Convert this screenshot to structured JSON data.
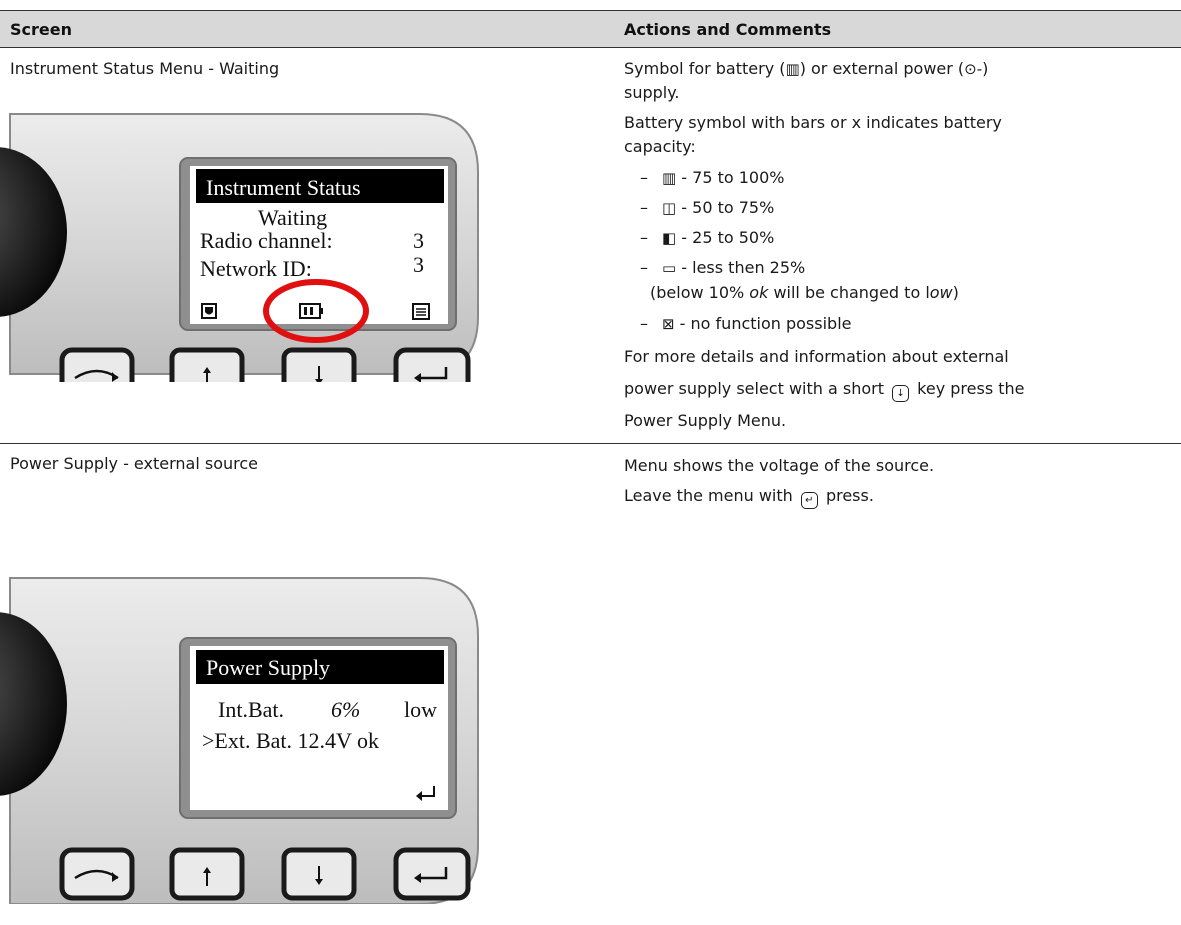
{
  "table": {
    "header": {
      "screen": "Screen",
      "actions": "Actions and Comments"
    }
  },
  "rows": [
    {
      "title": "Instrument Status Menu - Waiting",
      "lcd": {
        "heading": "Instrument Status",
        "line1": "Waiting",
        "line2_label": "Radio channel:",
        "line2_value": "3",
        "line3_label": "Network ID:",
        "line3_value": "3"
      },
      "comments": {
        "p1_a": "Symbol for battery (",
        "p1_sym_battery": "▥",
        "p1_b": ") or external power (",
        "p1_sym_ext": "⊙-",
        "p1_c": ")",
        "p1_line2": "supply.",
        "p2_line1": "Battery symbol with bars or x indicates battery",
        "p2_line2": "capacity:",
        "items": [
          {
            "dash": "–",
            "sym": "▥",
            "text": " - 75 to 100%"
          },
          {
            "dash": "–",
            "sym": "◫",
            "text": " - 50 to 75%"
          },
          {
            "dash": "–",
            "sym": "◧",
            "text": " - 25 to 50%"
          },
          {
            "dash": "–",
            "sym": "▭",
            "text": " - less then 25%"
          }
        ],
        "note_a": "(below 10% ",
        "note_ok": "ok",
        "note_b": " will be changed to l",
        "note_low": "ow",
        "note_c": ")",
        "item5_dash": "–",
        "item5_sym": "⊠",
        "item5_text": " - no function possible",
        "p3_line1": "For more details and information about external",
        "p3_line2_a": "power supply select with a short ",
        "p3_key": "↓",
        "p3_line2_b": " key press the",
        "p3_line3": "Power Supply Menu."
      }
    },
    {
      "title": "Power Supply - external source",
      "lcd": {
        "heading": "Power Supply",
        "line1_label": "Int.Bat.",
        "line1_pct": "6%",
        "line1_status": "low",
        "line2": ">Ext. Bat. 12.4V ok"
      },
      "comments": {
        "p1": "Menu shows the voltage of the source.",
        "p2_a": "Leave the menu with ",
        "p2_key": "↵",
        "p2_b": " press."
      }
    }
  ]
}
